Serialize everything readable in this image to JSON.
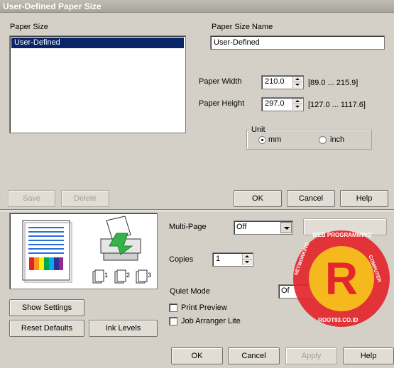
{
  "window": {
    "title": "User-Defined Paper Size"
  },
  "paper_size": {
    "label": "Paper Size",
    "items": [
      "User-Defined"
    ]
  },
  "paper_size_name": {
    "label": "Paper Size Name",
    "value": "User-Defined"
  },
  "paper_width": {
    "label": "Paper Width",
    "value": "210.0",
    "range": "[89.0 ... 215.9]"
  },
  "paper_height": {
    "label": "Paper Height",
    "value": "297.0",
    "range": "[127.0 ... 1117.6]"
  },
  "unit": {
    "label": "Unit",
    "options": [
      "mm",
      "inch"
    ],
    "selected": "mm"
  },
  "dialog_buttons": {
    "save": "Save",
    "delete": "Delete",
    "ok": "OK",
    "cancel": "Cancel",
    "help": "Help"
  },
  "printer_panel": {
    "multi_page_label": "Multi-Page",
    "multi_page_value": "Off",
    "copies_label": "Copies",
    "copies_value": "1",
    "quiet_mode_label": "Quiet Mode",
    "quiet_mode_value": "Of",
    "print_preview_label": "Print Preview",
    "print_preview_checked": false,
    "job_arranger_label": "Job Arranger Lite",
    "job_arranger_checked": false,
    "collate_pages": [
      "1",
      "2",
      "3"
    ]
  },
  "bottom_buttons": {
    "show_settings": "Show Settings",
    "reset_defaults": "Reset Defaults",
    "ink_levels": "Ink Levels",
    "ok": "OK",
    "cancel": "Cancel",
    "apply": "Apply",
    "help": "Help"
  },
  "watermark": {
    "text_top": "WEB PROGRAMMING",
    "text_left": "NETWORKING",
    "text_right": "COMPUTER",
    "text_bottom": "ROOT93.CO.ID",
    "letter": "R"
  },
  "colors": {
    "dialog_bg": "#d4d0c8",
    "selection": "#0a246a",
    "watermark_red": "#e3262b",
    "watermark_yellow": "#f6c11b"
  }
}
